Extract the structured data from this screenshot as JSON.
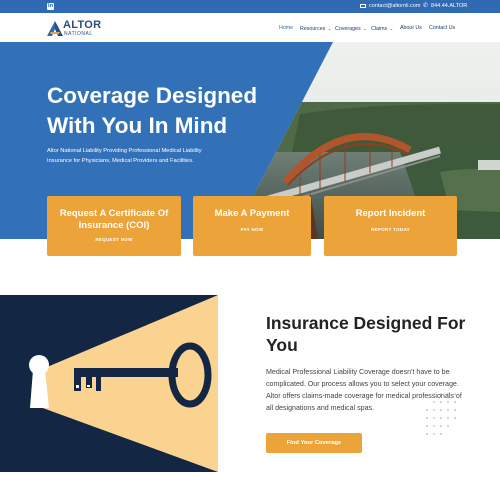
{
  "topbar": {
    "linkedin_icon": "linkedin-icon",
    "email": "contact@altornli.com",
    "phone": "844.44.ALTOR"
  },
  "logo": {
    "word1": "ALTOR",
    "word2": "NATIONAL"
  },
  "nav": [
    {
      "label": "Home",
      "active": true
    },
    {
      "label": "Resources",
      "chevron": true
    },
    {
      "label": "Coverages",
      "chevron": true
    },
    {
      "label": "Claims",
      "chevron": true
    },
    {
      "label": "About Us"
    },
    {
      "label": "Contact Us"
    }
  ],
  "hero": {
    "title": "Coverage Designed With You In Mind",
    "subtitle": "Altor National Liability Providing Professional Medical Liability Insurance for Physicians, Medical Providers and Facilities."
  },
  "cards": [
    {
      "title": "Request A Certificate Of Insurance (COI)",
      "link": "REQUEST NOW"
    },
    {
      "title": "Make A Payment",
      "link": "PAY NOW"
    },
    {
      "title": "Report Incident",
      "link": "REPORT TODAY"
    }
  ],
  "section": {
    "title": "Insurance Designed For You",
    "body": "Medical Professional Liability Coverage doesn't have to be complicated. Our process allows you to select your coverage. Altor offers claims-made coverage for medical professionals of all designations and medical spas.",
    "button": "Find Your Coverage"
  },
  "colors": {
    "brand_blue": "#2f6ab3",
    "hero_blue": "#3271b8",
    "accent_orange": "#eca33a",
    "navy": "#132643",
    "light_beam": "#f9d38f"
  }
}
